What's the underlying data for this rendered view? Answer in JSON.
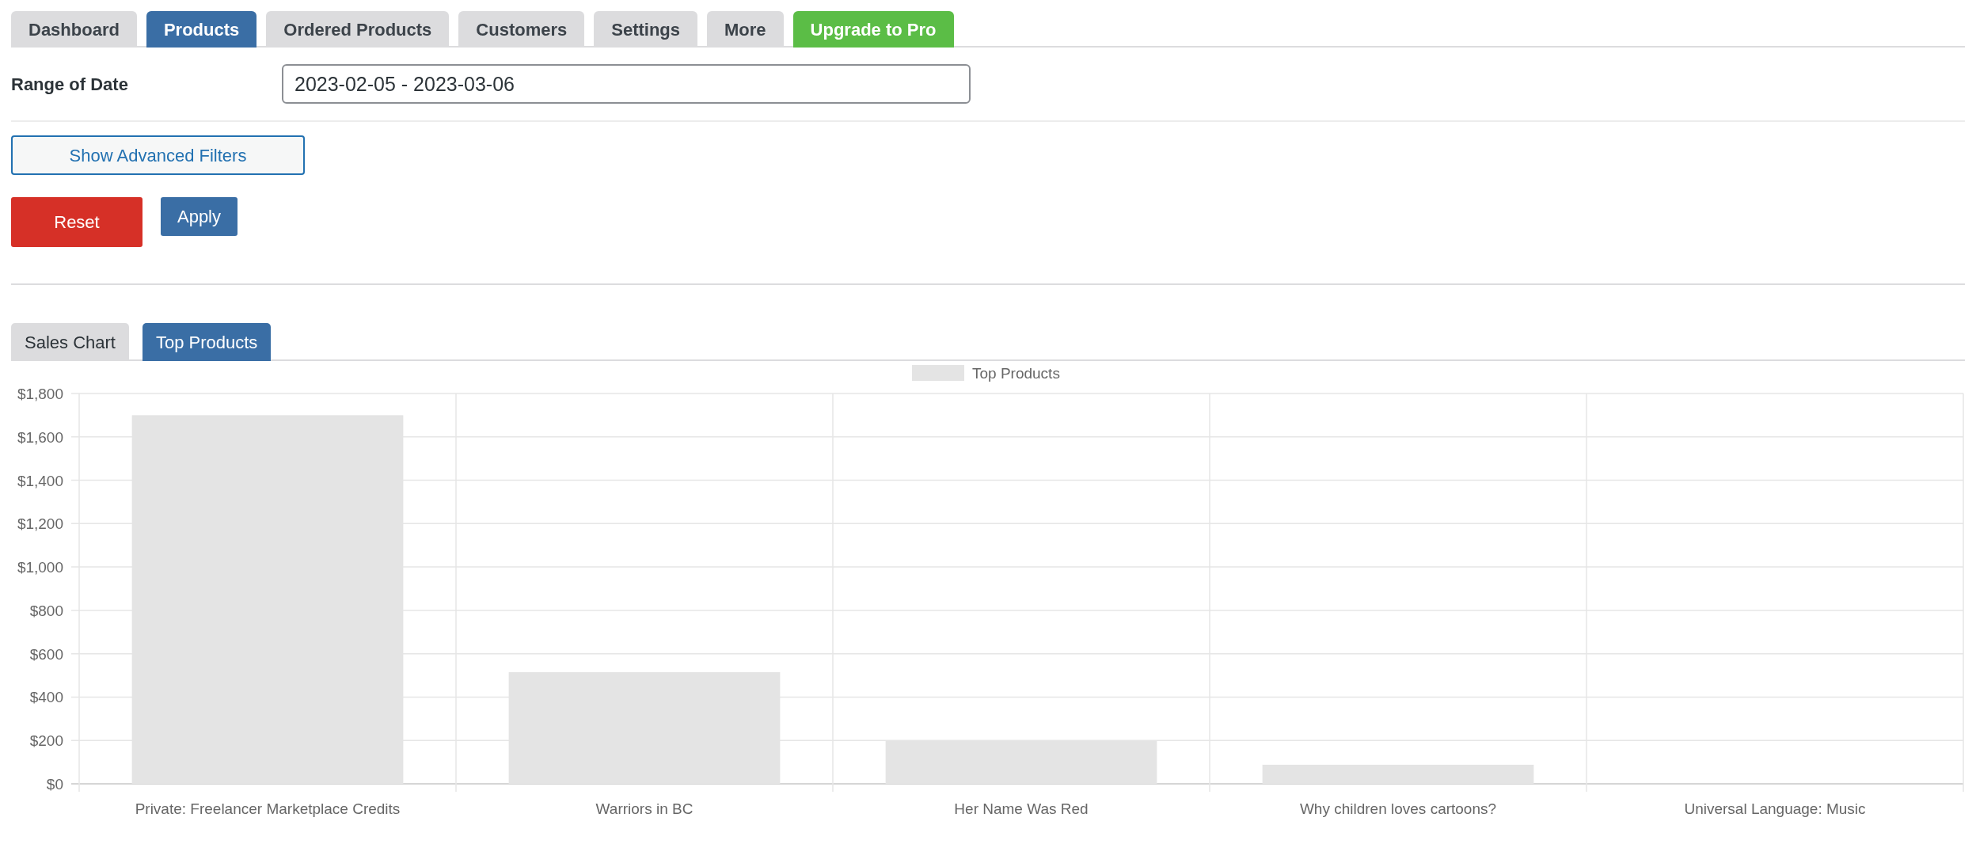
{
  "nav_tabs": [
    {
      "label": "Dashboard",
      "selected": false,
      "kind": "tab"
    },
    {
      "label": "Products",
      "selected": true,
      "kind": "tab"
    },
    {
      "label": "Ordered Products",
      "selected": false,
      "kind": "tab"
    },
    {
      "label": "Customers",
      "selected": false,
      "kind": "tab"
    },
    {
      "label": "Settings",
      "selected": false,
      "kind": "tab"
    },
    {
      "label": "More",
      "selected": false,
      "kind": "tab"
    },
    {
      "label": "Upgrade to Pro",
      "selected": false,
      "kind": "upgrade"
    }
  ],
  "date_range": {
    "label": "Range of Date",
    "value": "2023-02-05 - 2023-03-06"
  },
  "advanced_filters_button": "Show Advanced Filters",
  "reset_button": "Reset",
  "apply_button": "Apply",
  "chart_tabs": [
    {
      "label": "Sales Chart",
      "selected": false
    },
    {
      "label": "Top Products",
      "selected": true
    }
  ],
  "chart_data": {
    "type": "bar",
    "categories": [
      "Private: Freelancer Marketplace Credits",
      "Warriors in BC",
      "Her Name Was Red",
      "Why children loves cartoons?",
      "Universal Language: Music"
    ],
    "series": [
      {
        "name": "Top Products",
        "color": "#e4e4e4",
        "values": [
          1700,
          515,
          200,
          88,
          0
        ]
      }
    ],
    "ylim": [
      0,
      1800
    ],
    "grid": true,
    "yticks": [
      {
        "value": 0,
        "label": "$0"
      },
      {
        "value": 200,
        "label": "$200"
      },
      {
        "value": 400,
        "label": "$400"
      },
      {
        "value": 600,
        "label": "$600"
      },
      {
        "value": 800,
        "label": "$800"
      },
      {
        "value": 1000,
        "label": "$1,000"
      },
      {
        "value": 1200,
        "label": "$1,200"
      },
      {
        "value": 1400,
        "label": "$1,400"
      },
      {
        "value": 1600,
        "label": "$1,600"
      },
      {
        "value": 1800,
        "label": "$1,800"
      }
    ]
  }
}
